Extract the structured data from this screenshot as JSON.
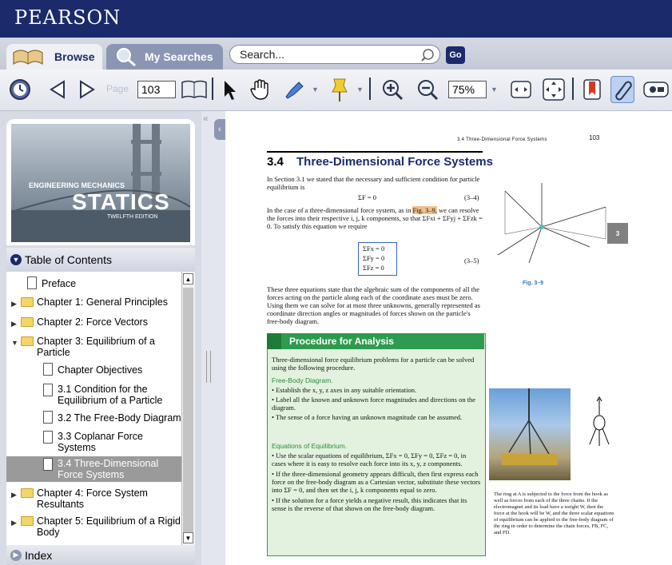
{
  "brand": "PEARSON",
  "tabs": {
    "browse": "Browse",
    "searches": "My Searches"
  },
  "search": {
    "value": "Search...",
    "go": "Go"
  },
  "toolbar": {
    "page_label": "Page",
    "page_value": "103",
    "zoom_value": "75%"
  },
  "book": {
    "line1": "ENGINEERING MECHANICS",
    "title": "STATICS",
    "edition": "TWELFTH EDITION"
  },
  "toc": {
    "header": "Table of Contents",
    "items": [
      {
        "label": "Preface"
      },
      {
        "label": "Chapter 1: General Principles"
      },
      {
        "label": "Chapter 2: Force Vectors"
      },
      {
        "label": "Chapter 3: Equilibrium of a Particle"
      },
      {
        "label": "Chapter Objectives"
      },
      {
        "label": "3.1 Condition for the Equilibrium of a Particle"
      },
      {
        "label": "3.2 The Free-Body Diagram"
      },
      {
        "label": "3.3 Coplanar Force Systems"
      },
      {
        "label": "3.4 Three-Dimensional Force Systems"
      },
      {
        "label": "Chapter 4: Force System Resultants"
      },
      {
        "label": "Chapter 5: Equilibrium of a Rigid Body"
      }
    ],
    "index": "Index"
  },
  "page": {
    "running_head": "3.4 Three-Dimensional Force Systems",
    "page_number": "103",
    "section_num": "3.4",
    "section_title": "Three-Dimensional Force Systems",
    "p1": "In Section 3.1 we stated that the necessary and sufficient condition for particle equilibrium is",
    "eq1": "ΣF = 0",
    "eq1_no": "(3–4)",
    "p2a": "In the case of a three-dimensional force system, as in ",
    "p2_ref": "Fig. 3–9,",
    "p2b": " we can resolve the forces into their respective i, j, k components, so that ΣFxi + ΣFyj + ΣFzk = 0. To satisfy this equation we require",
    "eq2": [
      "ΣFx = 0",
      "ΣFy = 0",
      "ΣFz = 0"
    ],
    "eq2_no": "(3–5)",
    "p3": "These three equations state that the algebraic sum of the components of all the forces acting on the particle along each of the coordinate axes must be zero. Using them we can solve for at most three unknowns, generally represented as coordinate direction angles or magnitudes of forces shown on the particle's free-body diagram.",
    "fig_label": "Fig. 3–9",
    "margin_tab": "3",
    "proc_title": "Procedure for Analysis",
    "proc_intro": "Three-dimensional force equilibrium problems for a particle can be solved using the following procedure.",
    "fbd_head": "Free-Body Diagram.",
    "fbd_items": [
      "Establish the x, y, z axes in any suitable orientation.",
      "Label all the known and unknown force magnitudes and directions on the diagram.",
      "The sense of a force having an unknown magnitude can be assumed."
    ],
    "eq_head": "Equations of Equilibrium.",
    "eq_items": [
      "Use the scalar equations of equilibrium, ΣFx = 0, ΣFy = 0, ΣFz = 0, in cases where it is easy to resolve each force into its x, y, z components.",
      "If the three-dimensional geometry appears difficult, then first express each force on the free-body diagram as a Cartesian vector, substitute these vectors into ΣF = 0, and then set the i, j, k components equal to zero.",
      "If the solution for a force yields a negative result, this indicates that its sense is the reverse of that shown on the free-body diagram."
    ],
    "caption": "The ring at A is subjected to the force from the hook as well as forces from each of the three chains. If the electromagnet and its load have a weight W, then the force at the hook will be W, and the three scalar equations of equilibrium can be applied to the free-body diagram of the ring in order to determine the chain forces, FB, FC, and FD."
  }
}
